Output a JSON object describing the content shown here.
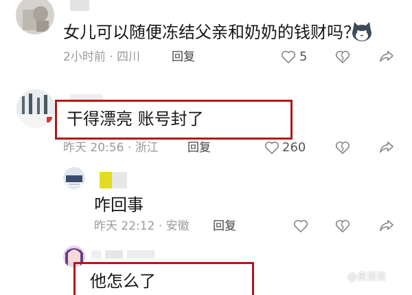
{
  "comments": [
    {
      "text": "女儿可以随便冻结父亲和奶奶的钱财吗？",
      "time": "2小时前",
      "location": "四川",
      "reply_label": "回复",
      "likes": "5"
    },
    {
      "text": "干得漂亮 账号封了",
      "time": "昨天 20:56",
      "location": "浙江",
      "reply_label": "回复",
      "likes": "260"
    },
    {
      "text": "咋回事",
      "time": "昨天 22:12",
      "location": "安徽",
      "reply_label": "回复",
      "likes": ""
    },
    {
      "text": "他怎么了"
    }
  ],
  "meta_separator": "·",
  "watermark": "@良语说",
  "colors": {
    "highlight": "#b41616",
    "meta_text": "#9a9a9a",
    "text": "#161616"
  },
  "icons": [
    "heart-icon",
    "dislike-heart-icon",
    "share-icon",
    "cat-emoji-icon"
  ]
}
